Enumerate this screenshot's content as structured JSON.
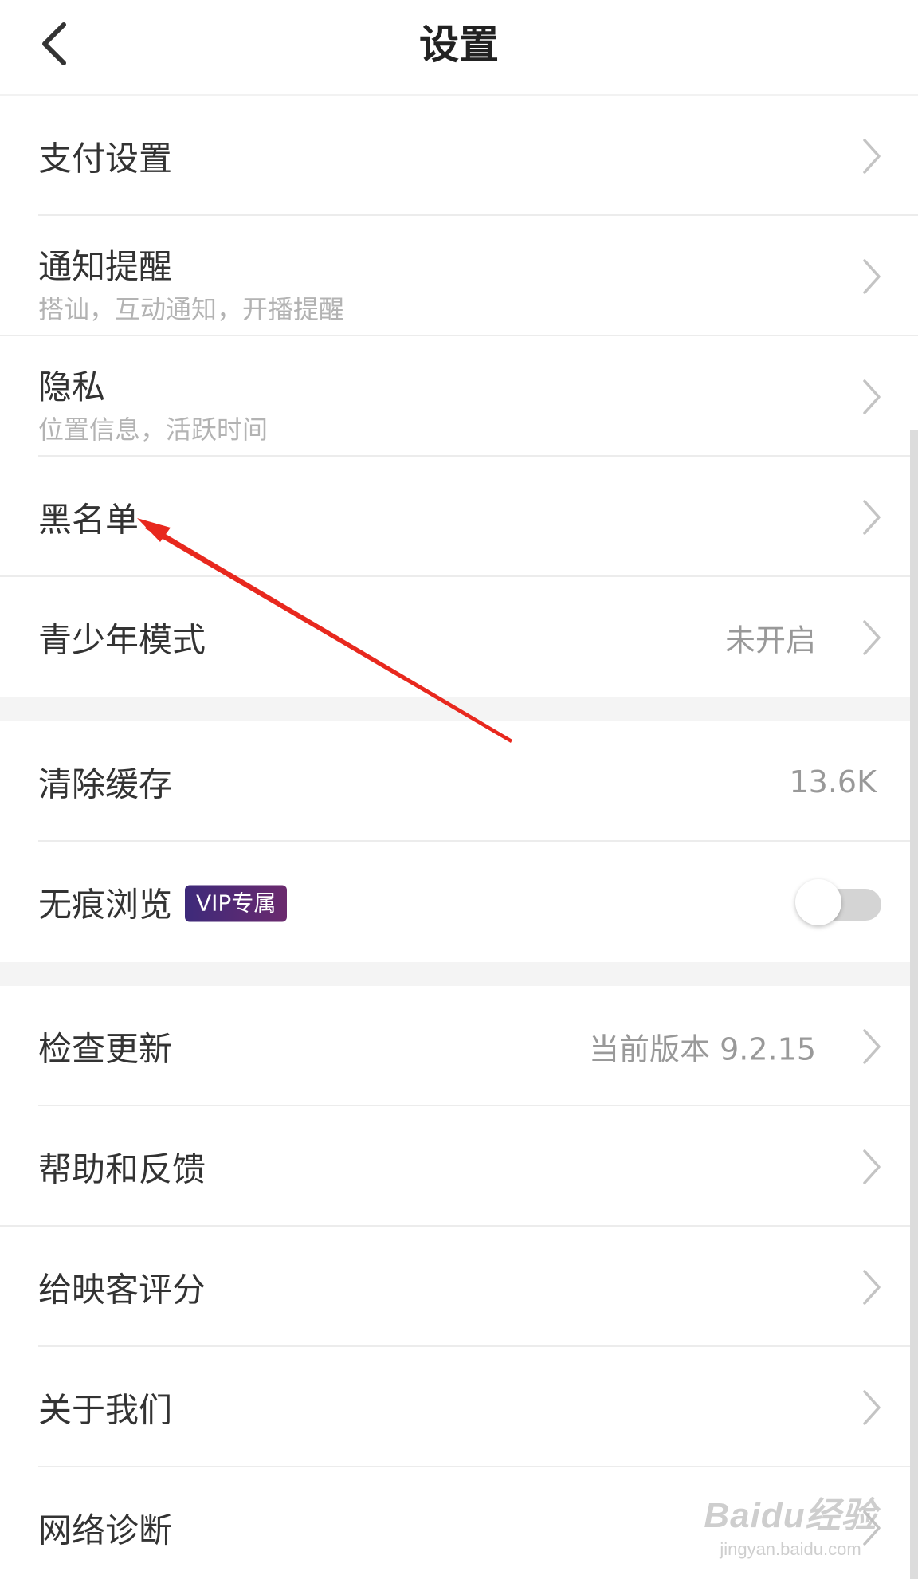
{
  "header": {
    "title": "设置"
  },
  "sections": [
    {
      "rows": [
        {
          "name": "payment",
          "title": "支付设置"
        },
        {
          "name": "notifications",
          "title": "通知提醒",
          "subtitle": "搭讪，互动通知，开播提醒"
        },
        {
          "name": "privacy",
          "title": "隐私",
          "subtitle": "位置信息，活跃时间"
        },
        {
          "name": "blacklist",
          "title": "黑名单"
        },
        {
          "name": "teen-mode",
          "title": "青少年模式",
          "value": "未开启"
        }
      ]
    },
    {
      "rows": [
        {
          "name": "clear-cache",
          "title": "清除缓存",
          "value": "13.6K"
        },
        {
          "name": "incognito",
          "title": "无痕浏览",
          "badge": "VIP专属",
          "toggle_on": false
        }
      ]
    },
    {
      "rows": [
        {
          "name": "check-update",
          "title": "检查更新",
          "value": "当前版本 9.2.15"
        },
        {
          "name": "help-feedback",
          "title": "帮助和反馈"
        },
        {
          "name": "rate-app",
          "title": "给映客评分"
        },
        {
          "name": "about-us",
          "title": "关于我们"
        },
        {
          "name": "network-diagnosis",
          "title": "网络诊断"
        }
      ]
    }
  ],
  "watermark": {
    "logo": "Baidu经验",
    "url": "jingyan.baidu.com"
  },
  "colors": {
    "annotation_arrow": "#e8281e",
    "vip_badge_start": "#3d2a7a",
    "vip_badge_end": "#6b2a6e"
  },
  "icons": {
    "back": "chevron-left-icon",
    "row_arrow": "chevron-right-icon"
  }
}
